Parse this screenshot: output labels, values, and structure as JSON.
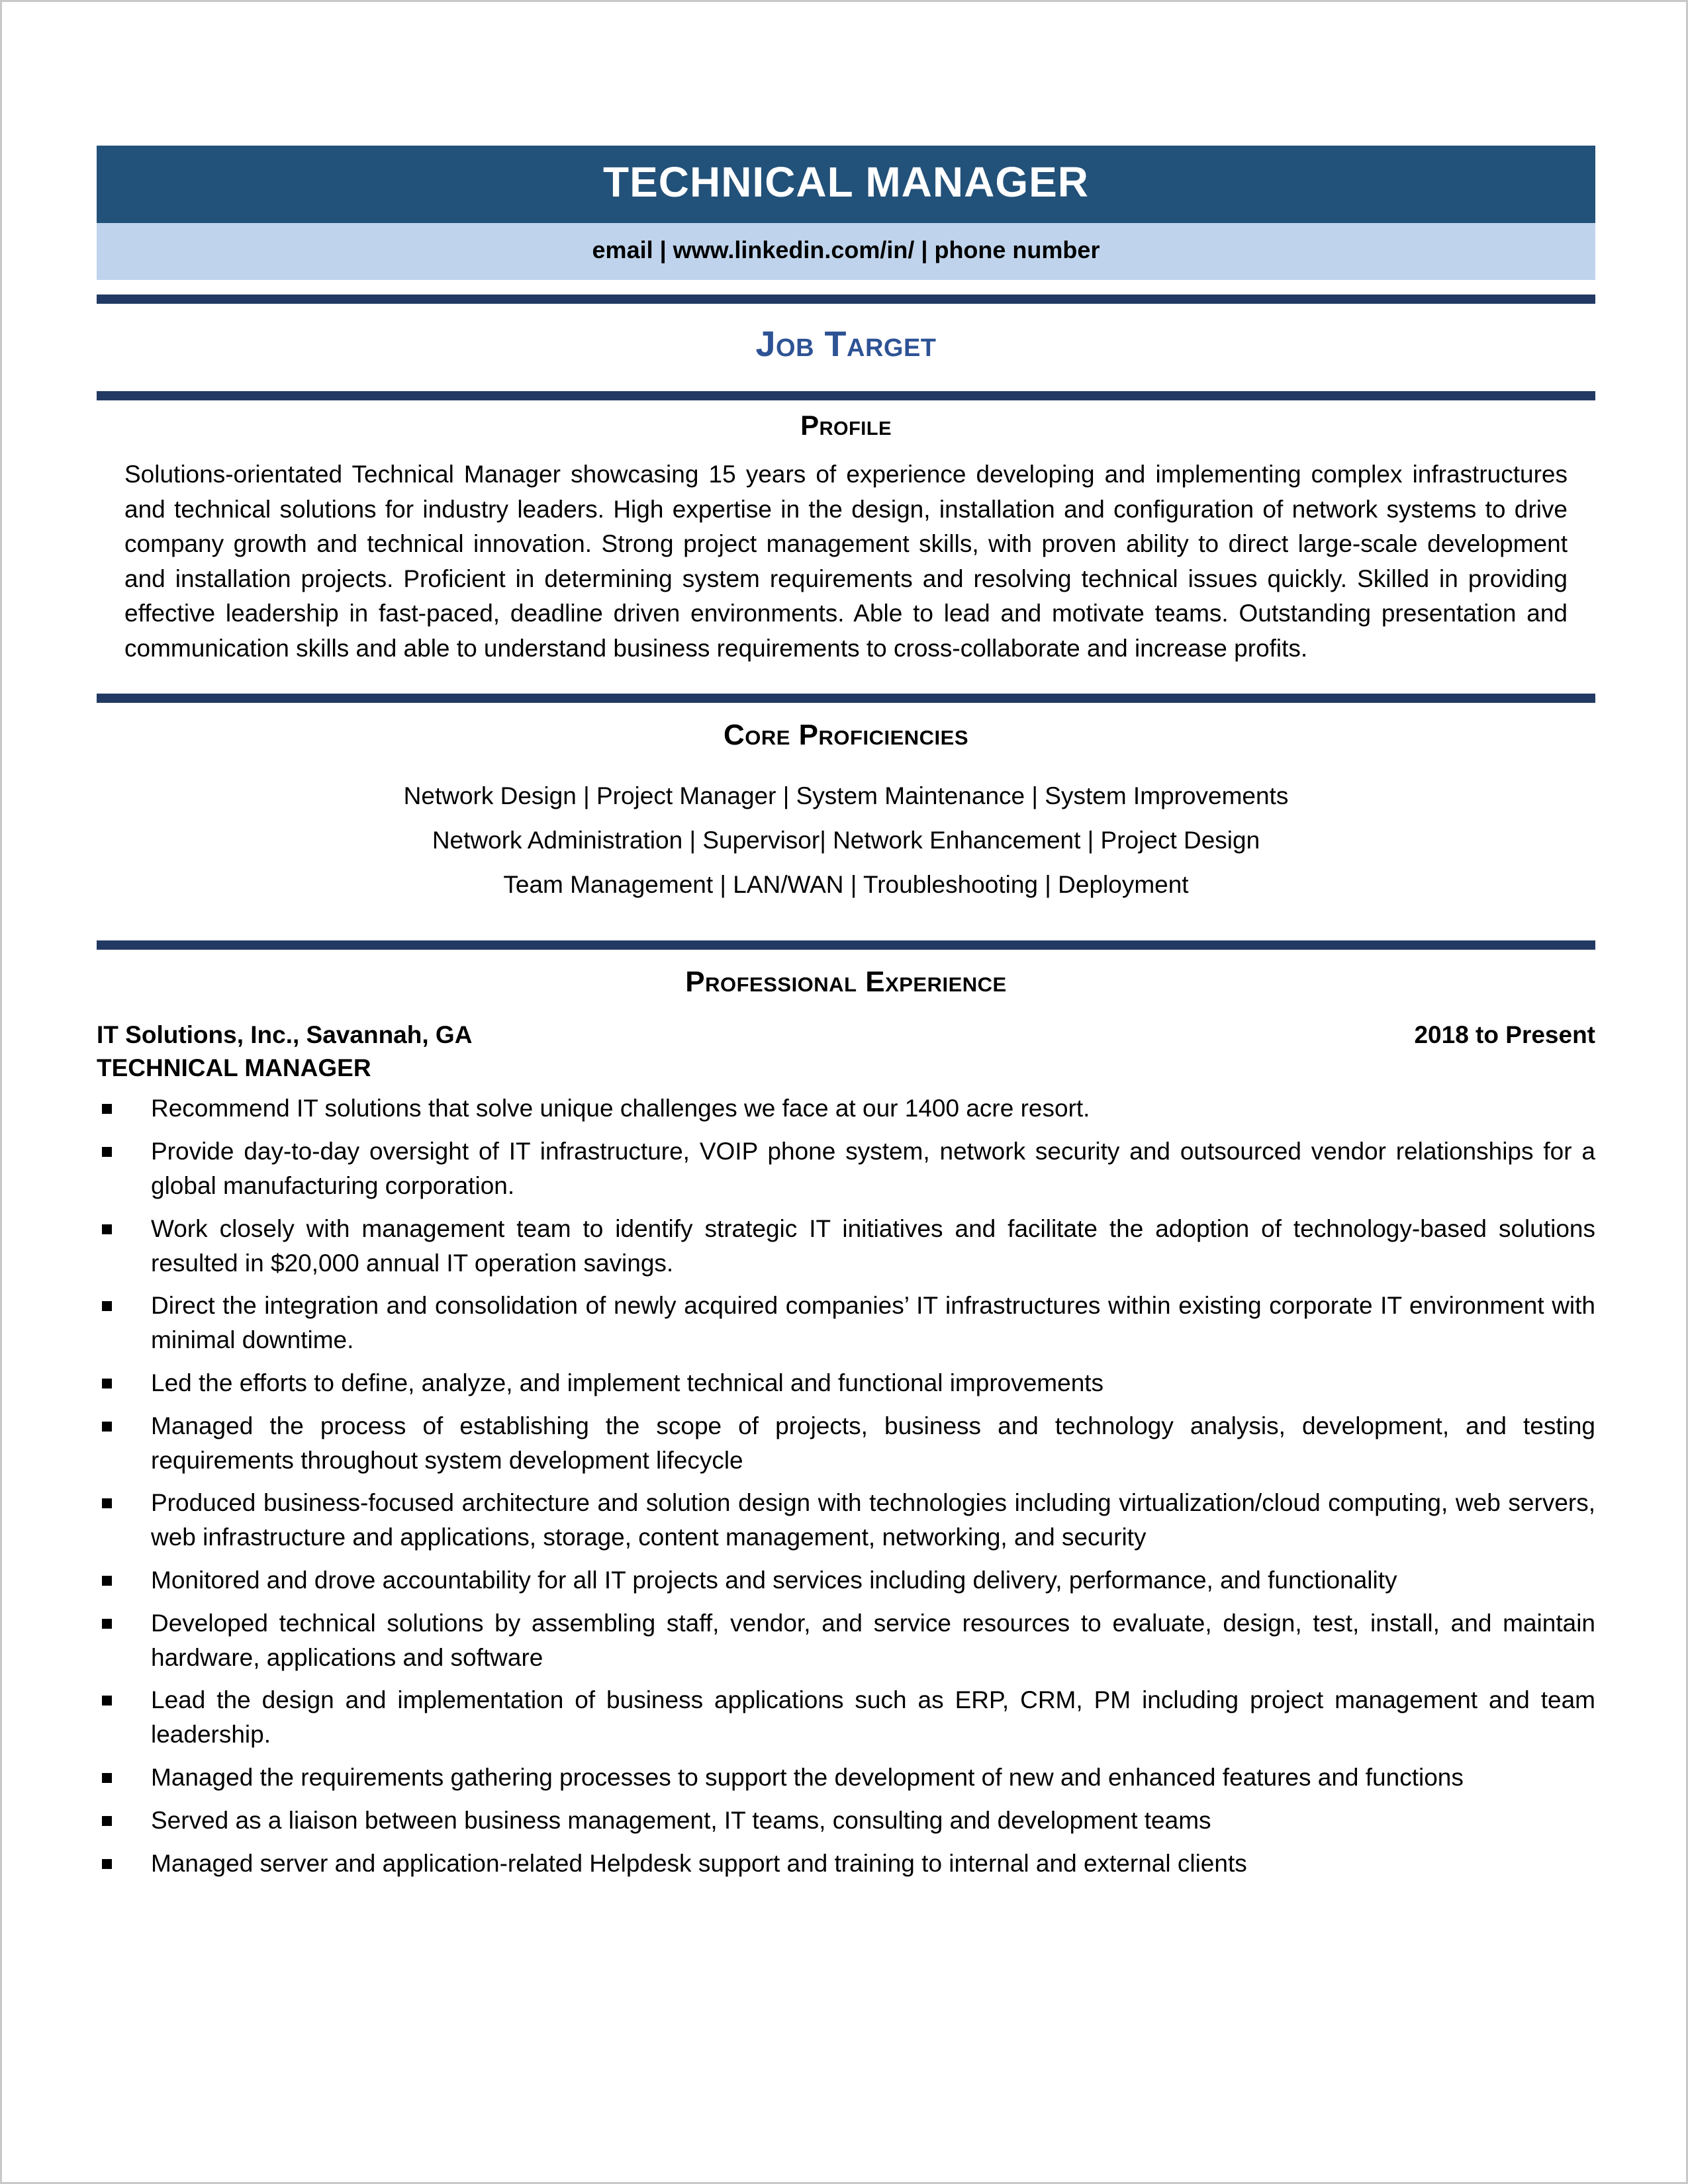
{
  "header": {
    "title": "TECHNICAL MANAGER",
    "contact": "email | www.linkedin.com/in/ | phone number"
  },
  "colors": {
    "banner_blue": "#225179",
    "contact_blue": "#BFD4EC",
    "rule_navy": "#223A63",
    "heading_blue": "#2E5395"
  },
  "job_target": {
    "heading": "Job Target"
  },
  "profile": {
    "heading": "Profile",
    "body": "Solutions-orientated Technical Manager showcasing 15 years of experience developing and implementing complex infrastructures and technical solutions for industry leaders.  High expertise in the design, installation and configuration of network systems to drive company growth and technical innovation.  Strong project management skills, with proven ability to direct large-scale development and installation projects.  Proficient in determining system requirements and resolving technical issues quickly. Skilled in providing effective leadership in fast-paced, deadline driven environments. Able to lead and motivate teams. Outstanding presentation and communication skills and able to understand business requirements to cross-collaborate and increase profits."
  },
  "core_proficiencies": {
    "heading": "Core Proficiencies",
    "rows": [
      "Network Design | Project Manager | System Maintenance | System Improvements",
      "Network Administration | Supervisor| Network Enhancement | Project Design",
      "Team Management | LAN/WAN | Troubleshooting | Deployment"
    ]
  },
  "professional_experience": {
    "heading": "Professional Experience",
    "jobs": [
      {
        "company": "IT Solutions, Inc., Savannah, GA",
        "dates": "2018 to Present",
        "role": "TECHNICAL MANAGER",
        "bullets": [
          "Recommend IT solutions that solve unique challenges we face at our 1400 acre resort.",
          "Provide day-to-day oversight of IT infrastructure, VOIP phone system, network security and outsourced vendor relationships for a global manufacturing corporation.",
          "Work closely with management team to identify strategic IT initiatives and facilitate the adoption of technology-based solutions resulted in $20,000 annual IT operation savings.",
          "Direct the integration and consolidation of newly acquired companies’ IT infrastructures within existing corporate IT environment with minimal downtime.",
          "Led the efforts to define, analyze, and implement technical and functional improvements",
          "Managed the process of establishing the scope of projects, business and technology analysis, development, and testing requirements throughout system development lifecycle",
          "Produced business-focused architecture and solution design with technologies including virtualization/cloud computing, web servers, web infrastructure and applications, storage, content management, networking, and security",
          "Monitored and drove accountability for all IT projects and services including delivery, performance, and functionality",
          "Developed technical solutions by assembling staff, vendor, and service resources to evaluate, design, test, install, and maintain hardware, applications and software",
          "Lead the design and implementation of business applications such as ERP, CRM, PM including project management and team leadership.",
          "Managed the requirements gathering processes to support the development of new and enhanced features and functions",
          "Served as a liaison between business management, IT teams, consulting and development teams",
          "Managed server and application-related Helpdesk support and training to internal and external clients"
        ]
      }
    ]
  }
}
